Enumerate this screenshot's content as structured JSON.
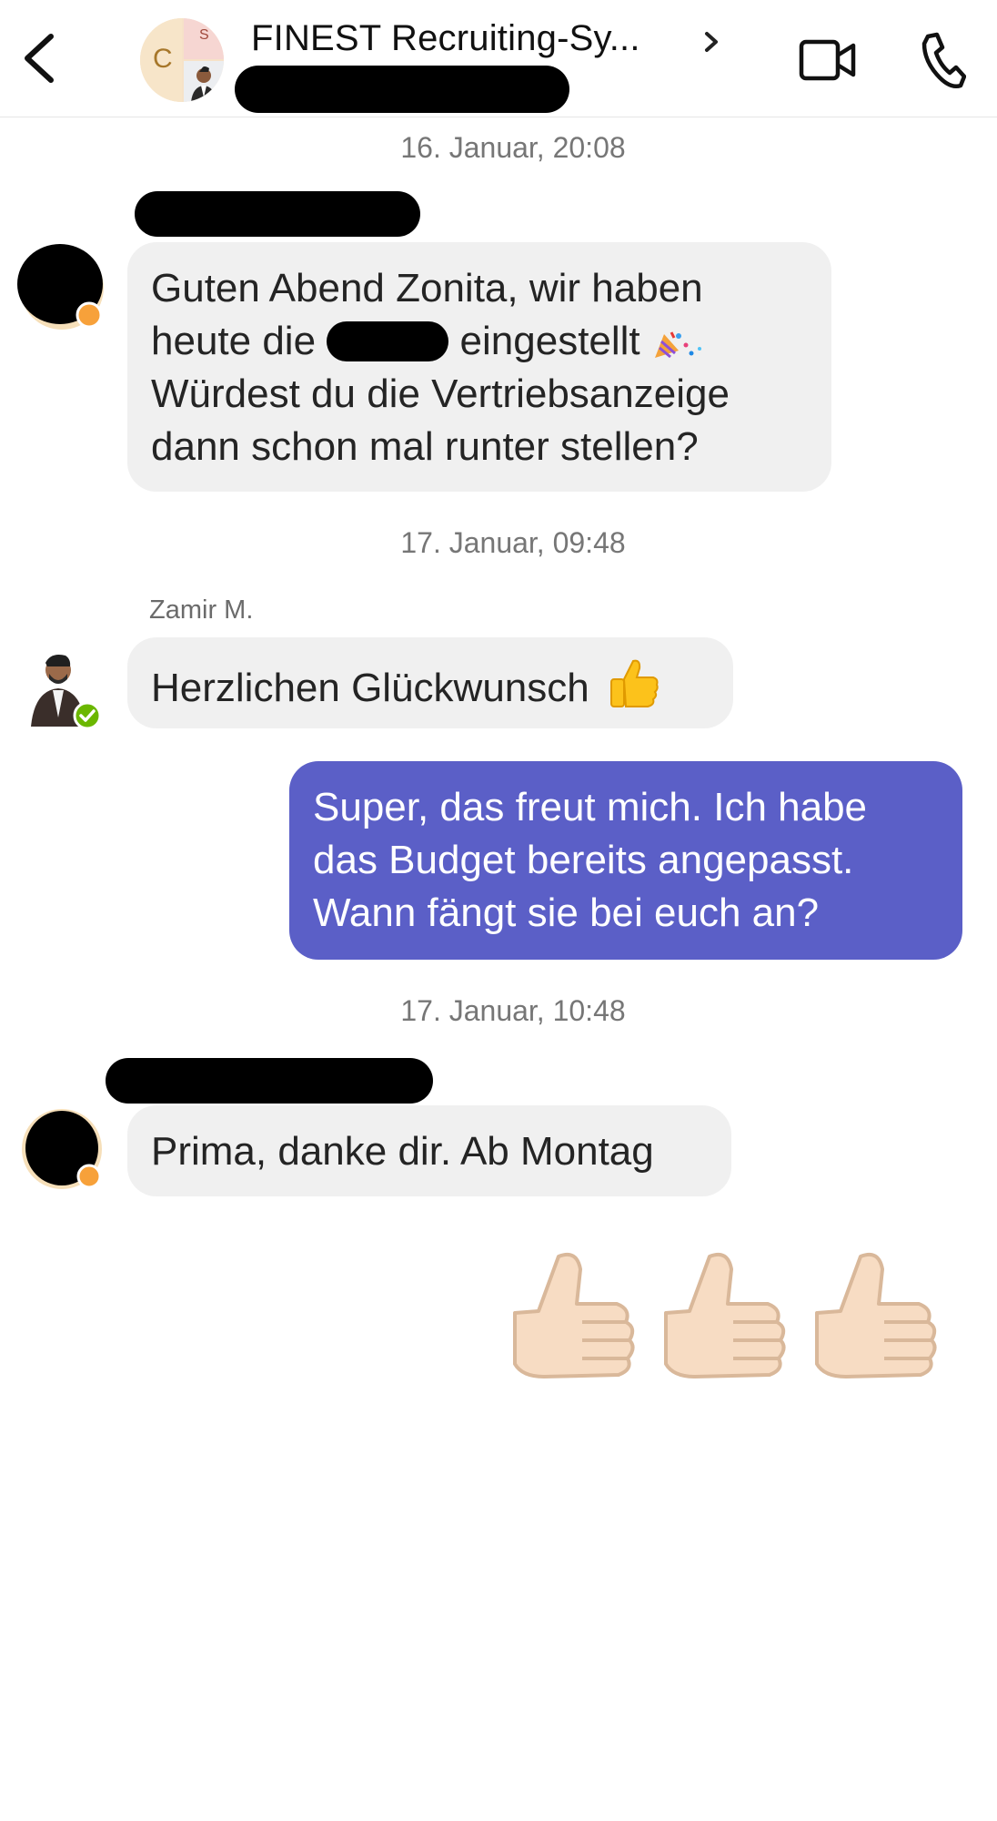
{
  "header": {
    "title": "FINEST Recruiting-Sy...",
    "avatar_letter_left": "C",
    "avatar_letter_right": "S"
  },
  "messages": {
    "ts1": "16. Januar, 20:08",
    "msg1_line1": "Guten Abend Zonita, wir haben",
    "msg1_line2_a": "heute die",
    "msg1_line2_b": "eingestellt",
    "msg1_line3": "Würdest du die Vertriebsanzeige",
    "msg1_line4": "dann schon mal runter stellen?",
    "ts2": "17. Januar, 09:48",
    "sender2": "Zamir M.",
    "msg2": "Herzlichen Glückwunsch",
    "msg3_line1": "Super, das freut mich. Ich habe",
    "msg3_line2": "das Budget bereits angepasst.",
    "msg3_line3": "Wann fängt sie bei euch an?",
    "ts3": "17. Januar, 10:48",
    "msg4": "Prima, danke dir. Ab Montag"
  },
  "colors": {
    "outgoing_bubble": "#5b5fc7",
    "incoming_bubble": "#f0f0f0",
    "status_available": "#6bb700",
    "status_away": "#f7a13a"
  },
  "icons": [
    "back-chevron-icon",
    "chevron-right-icon",
    "video-call-icon",
    "phone-call-icon",
    "party-popper-icon",
    "thumbs-up-icon"
  ]
}
